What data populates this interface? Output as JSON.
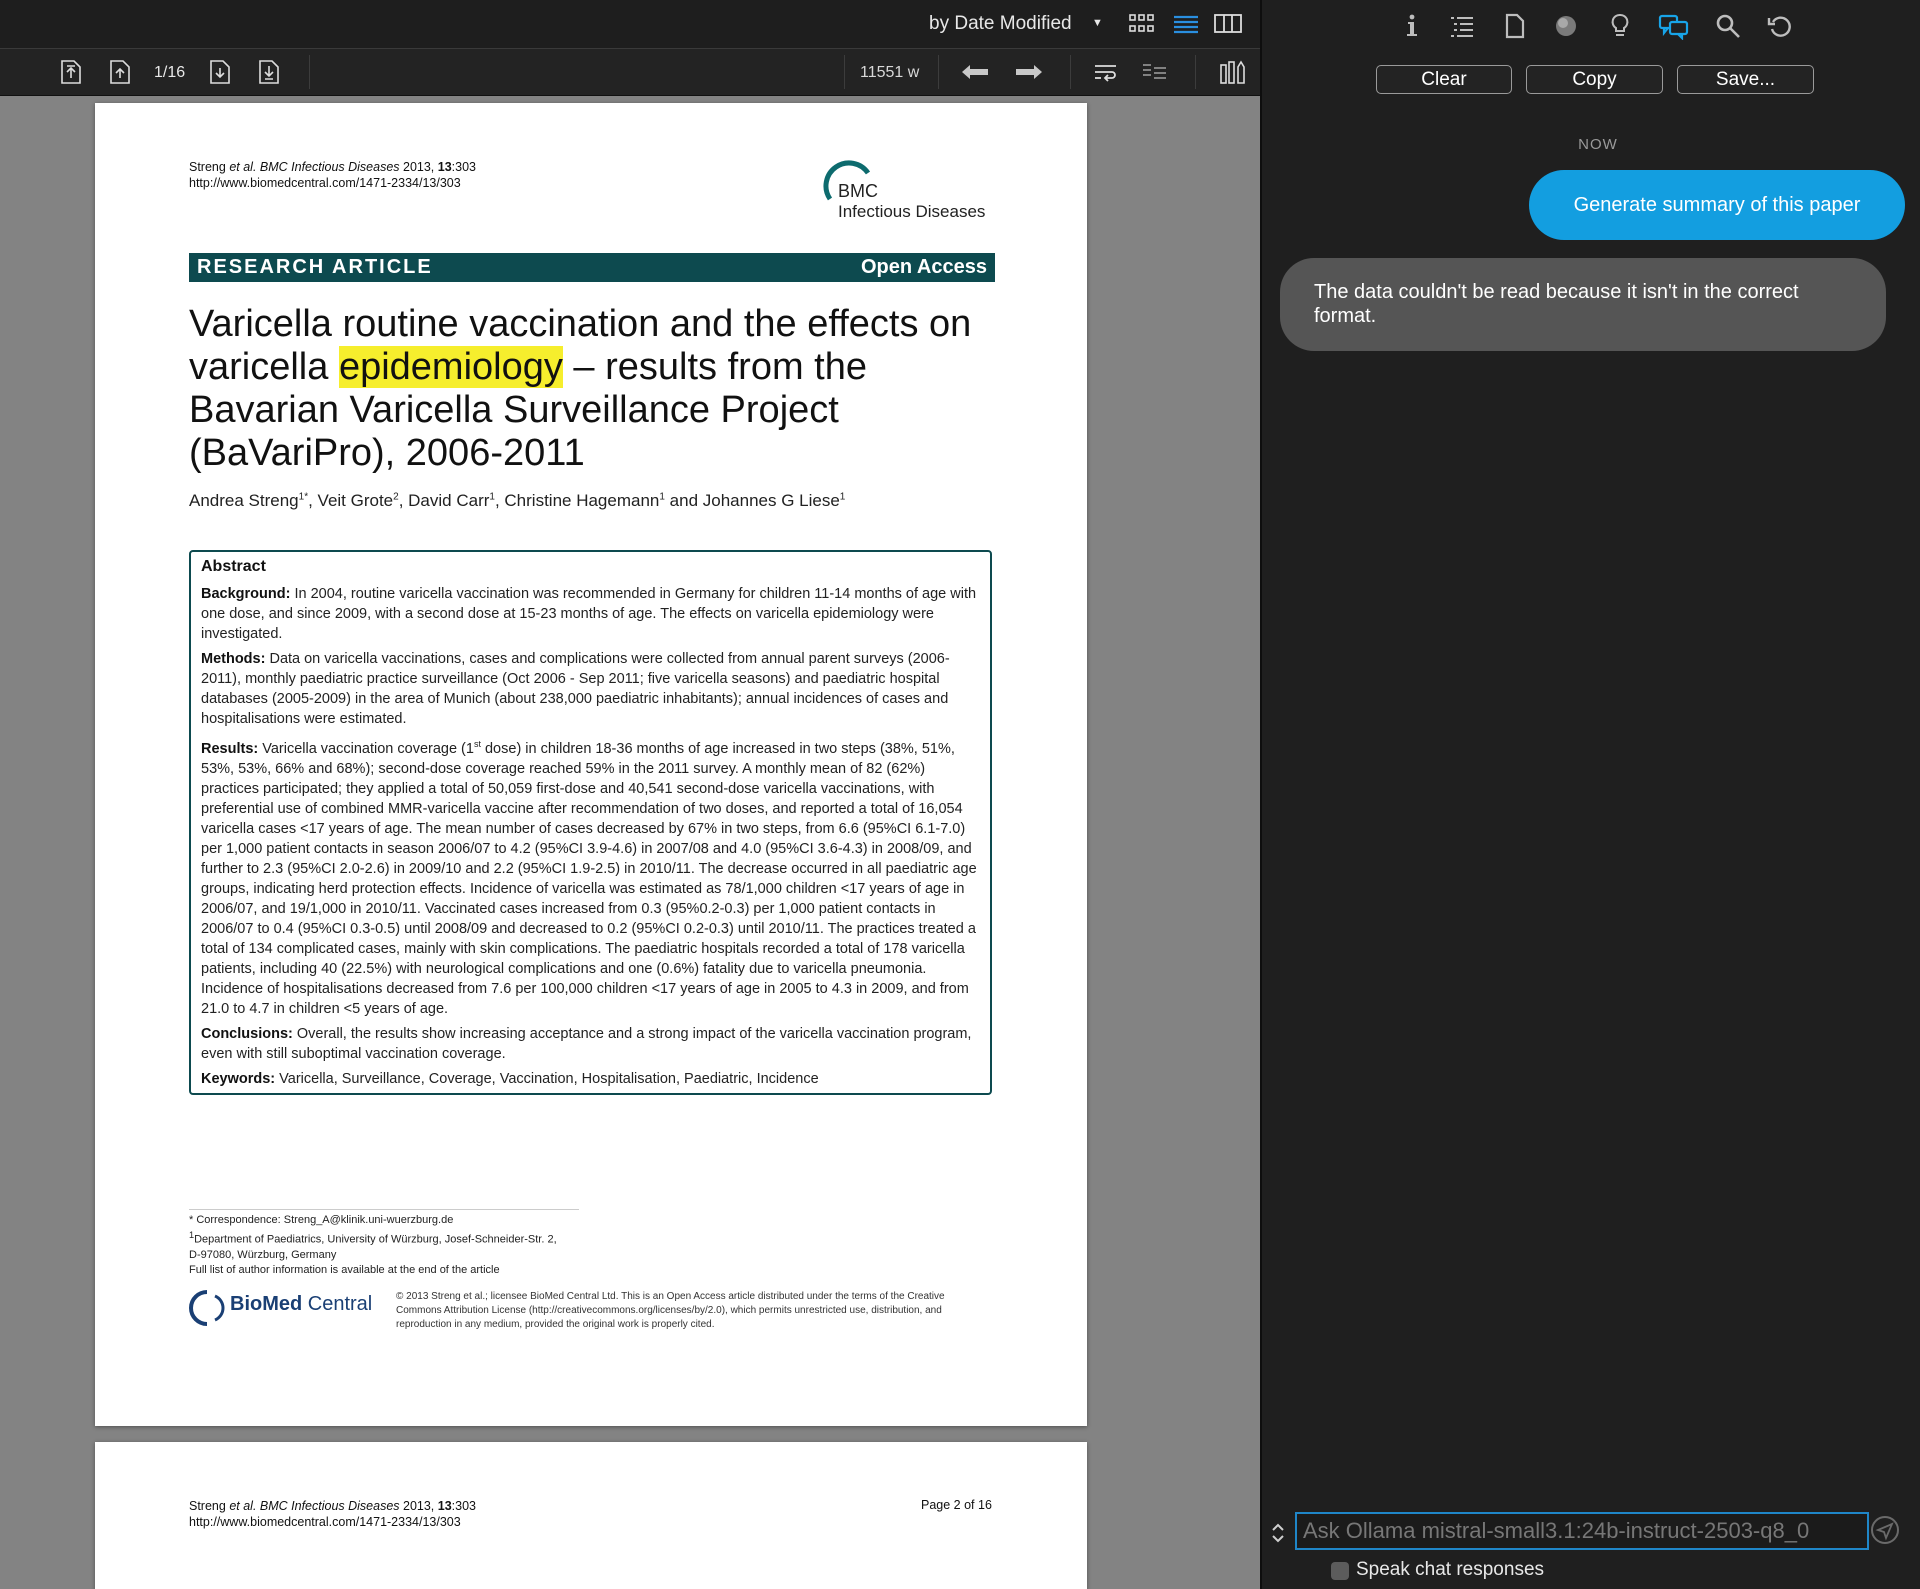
{
  "left_pane": {
    "sort_label": "by Date Modified",
    "page_indicator": "1/16",
    "word_count": "11551 w"
  },
  "page1": {
    "citation_line1_pre": "Streng ",
    "citation_line1_etal": "et al.",
    "citation_line1_journal": " BMC Infectious Diseases",
    "citation_line1_rest": " 2013, ",
    "citation_line1_vol": "13",
    "citation_line1_page": ":303",
    "citation_line2": "http://www.biomedcentral.com/1471-2334/13/303",
    "journal_logo_bmc": "BMC",
    "journal_logo_name": "Infectious Diseases",
    "band_left": "RESEARCH ARTICLE",
    "band_right": "Open Access",
    "title_part1": "Varicella routine vaccination and the effects on varicella ",
    "title_highlight": "epidemiology",
    "title_part2": " – results from the Bavarian Varicella Surveillance Project (BaVariPro), 2006-2011",
    "authors": [
      {
        "name": "Andrea Streng",
        "sup": "1*"
      },
      {
        "name": ", Veit Grote",
        "sup": "2"
      },
      {
        "name": ", David Carr",
        "sup": "1"
      },
      {
        "name": ", Christine Hagemann",
        "sup": "1"
      },
      {
        "name": " and Johannes G Liese",
        "sup": "1"
      }
    ],
    "abstract": {
      "heading": "Abstract",
      "background_label": "Background:",
      "background_text": " In 2004, routine varicella vaccination was recommended in Germany for children 11-14 months of age with one dose, and since 2009, with a second dose at 15-23 months of age. The effects on varicella epidemiology were investigated.",
      "methods_label": "Methods:",
      "methods_text": " Data on varicella vaccinations, cases and complications were collected from annual parent surveys (2006-2011), monthly paediatric practice surveillance (Oct 2006 - Sep 2011; five varicella seasons) and paediatric hospital databases (2005-2009) in the area of Munich (about 238,000 paediatric inhabitants); annual incidences of cases and hospitalisations were estimated.",
      "results_label": "Results:",
      "results_text_a": " Varicella vaccination coverage (1",
      "results_sup": "st",
      "results_text_b": " dose) in children 18-36 months of age increased in two steps (38%, 51%, 53%, 53%, 66% and 68%); second-dose coverage reached 59% in the 2011 survey. A monthly mean of 82 (62%) practices participated; they applied a total of 50,059 first-dose and 40,541 second-dose varicella vaccinations, with preferential use of combined MMR-varicella vaccine after recommendation of two doses, and reported a total of 16,054 varicella cases <17 years of age. The mean number of cases decreased by 67% in two steps, from 6.6 (95%CI 6.1-7.0) per 1,000 patient contacts in season 2006/07 to 4.2 (95%CI 3.9-4.6) in 2007/08 and 4.0 (95%CI 3.6-4.3) in 2008/09, and further to 2.3 (95%CI 2.0-2.6) in 2009/10 and 2.2 (95%CI 1.9-2.5) in 2010/11. The decrease occurred in all paediatric age groups, indicating herd protection effects. Incidence of varicella was estimated as 78/1,000 children <17 years of age in 2006/07, and 19/1,000 in 2010/11. Vaccinated cases increased from 0.3 (95%0.2-0.3) per 1,000 patient contacts in 2006/07 to 0.4 (95%CI 0.3-0.5) until 2008/09 and decreased to 0.2 (95%CI 0.2-0.3) until 2010/11. The practices treated a total of 134 complicated cases, mainly with skin complications. The paediatric hospitals recorded a total of 178 varicella patients, including 40 (22.5%) with neurological complications and one (0.6%) fatality due to varicella pneumonia. Incidence of hospitalisations decreased from 7.6 per 100,000 children <17 years of age in 2005 to 4.3 in 2009, and from 21.0 to 4.7 in children <5 years of age.",
      "conclusions_label": "Conclusions:",
      "conclusions_text": " Overall, the results show increasing acceptance and a strong impact of the varicella vaccination program, even with still suboptimal vaccination coverage.",
      "keywords_label": "Keywords:",
      "keywords_text": " Varicella, Surveillance, Coverage, Vaccination, Hospitalisation, Paediatric, Incidence"
    },
    "footnote_corr": "* Correspondence: Streng_A@klinik.uni-wuerzburg.de",
    "footnote_sup": "1",
    "footnote_dept": "Department of Paediatrics, University of Würzburg, Josef-Schneider-Str. 2,",
    "footnote_dept2": "D-97080, Würzburg, Germany",
    "footnote_full": "Full list of author information is available at the end of the article",
    "bmc_logo_bold": "BioMed",
    "bmc_logo_rest": " Central",
    "license": "© 2013 Streng et al.; licensee BioMed Central Ltd. This is an Open Access article distributed under the terms of the Creative Commons Attribution License (http://creativecommons.org/licenses/by/2.0), which permits unrestricted use, distribution, and reproduction in any medium, provided the original work is properly cited."
  },
  "page2": {
    "page_label": "Page 2 of 16"
  },
  "chat": {
    "buttons": {
      "clear": "Clear",
      "copy": "Copy",
      "save": "Save..."
    },
    "time_label": "NOW",
    "user_message": "Generate summary of this paper",
    "ai_message": "The data couldn't be read because it isn't in the correct format.",
    "input_placeholder": "Ask Ollama mistral-small3.1:24b-instruct-2503-q8_0",
    "speak_label": "Speak chat responses"
  },
  "colors": {
    "accent": "#139ee0",
    "band": "#0d4a4f",
    "highlight": "#f6ee2d",
    "ai_bubble": "#555555"
  }
}
